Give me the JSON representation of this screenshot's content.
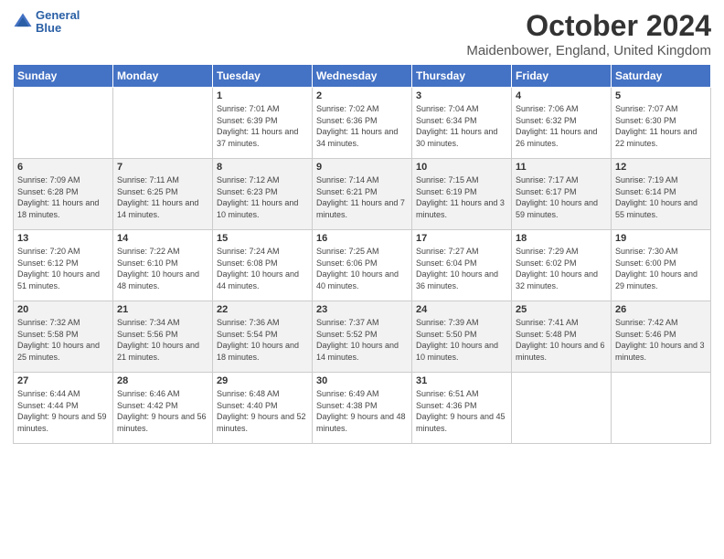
{
  "logo": {
    "line1": "General",
    "line2": "Blue"
  },
  "title": "October 2024",
  "subtitle": "Maidenbower, England, United Kingdom",
  "days_of_week": [
    "Sunday",
    "Monday",
    "Tuesday",
    "Wednesday",
    "Thursday",
    "Friday",
    "Saturday"
  ],
  "weeks": [
    [
      {
        "day": "",
        "info": ""
      },
      {
        "day": "",
        "info": ""
      },
      {
        "day": "1",
        "info": "Sunrise: 7:01 AM\nSunset: 6:39 PM\nDaylight: 11 hours and 37 minutes."
      },
      {
        "day": "2",
        "info": "Sunrise: 7:02 AM\nSunset: 6:36 PM\nDaylight: 11 hours and 34 minutes."
      },
      {
        "day": "3",
        "info": "Sunrise: 7:04 AM\nSunset: 6:34 PM\nDaylight: 11 hours and 30 minutes."
      },
      {
        "day": "4",
        "info": "Sunrise: 7:06 AM\nSunset: 6:32 PM\nDaylight: 11 hours and 26 minutes."
      },
      {
        "day": "5",
        "info": "Sunrise: 7:07 AM\nSunset: 6:30 PM\nDaylight: 11 hours and 22 minutes."
      }
    ],
    [
      {
        "day": "6",
        "info": "Sunrise: 7:09 AM\nSunset: 6:28 PM\nDaylight: 11 hours and 18 minutes."
      },
      {
        "day": "7",
        "info": "Sunrise: 7:11 AM\nSunset: 6:25 PM\nDaylight: 11 hours and 14 minutes."
      },
      {
        "day": "8",
        "info": "Sunrise: 7:12 AM\nSunset: 6:23 PM\nDaylight: 11 hours and 10 minutes."
      },
      {
        "day": "9",
        "info": "Sunrise: 7:14 AM\nSunset: 6:21 PM\nDaylight: 11 hours and 7 minutes."
      },
      {
        "day": "10",
        "info": "Sunrise: 7:15 AM\nSunset: 6:19 PM\nDaylight: 11 hours and 3 minutes."
      },
      {
        "day": "11",
        "info": "Sunrise: 7:17 AM\nSunset: 6:17 PM\nDaylight: 10 hours and 59 minutes."
      },
      {
        "day": "12",
        "info": "Sunrise: 7:19 AM\nSunset: 6:14 PM\nDaylight: 10 hours and 55 minutes."
      }
    ],
    [
      {
        "day": "13",
        "info": "Sunrise: 7:20 AM\nSunset: 6:12 PM\nDaylight: 10 hours and 51 minutes."
      },
      {
        "day": "14",
        "info": "Sunrise: 7:22 AM\nSunset: 6:10 PM\nDaylight: 10 hours and 48 minutes."
      },
      {
        "day": "15",
        "info": "Sunrise: 7:24 AM\nSunset: 6:08 PM\nDaylight: 10 hours and 44 minutes."
      },
      {
        "day": "16",
        "info": "Sunrise: 7:25 AM\nSunset: 6:06 PM\nDaylight: 10 hours and 40 minutes."
      },
      {
        "day": "17",
        "info": "Sunrise: 7:27 AM\nSunset: 6:04 PM\nDaylight: 10 hours and 36 minutes."
      },
      {
        "day": "18",
        "info": "Sunrise: 7:29 AM\nSunset: 6:02 PM\nDaylight: 10 hours and 32 minutes."
      },
      {
        "day": "19",
        "info": "Sunrise: 7:30 AM\nSunset: 6:00 PM\nDaylight: 10 hours and 29 minutes."
      }
    ],
    [
      {
        "day": "20",
        "info": "Sunrise: 7:32 AM\nSunset: 5:58 PM\nDaylight: 10 hours and 25 minutes."
      },
      {
        "day": "21",
        "info": "Sunrise: 7:34 AM\nSunset: 5:56 PM\nDaylight: 10 hours and 21 minutes."
      },
      {
        "day": "22",
        "info": "Sunrise: 7:36 AM\nSunset: 5:54 PM\nDaylight: 10 hours and 18 minutes."
      },
      {
        "day": "23",
        "info": "Sunrise: 7:37 AM\nSunset: 5:52 PM\nDaylight: 10 hours and 14 minutes."
      },
      {
        "day": "24",
        "info": "Sunrise: 7:39 AM\nSunset: 5:50 PM\nDaylight: 10 hours and 10 minutes."
      },
      {
        "day": "25",
        "info": "Sunrise: 7:41 AM\nSunset: 5:48 PM\nDaylight: 10 hours and 6 minutes."
      },
      {
        "day": "26",
        "info": "Sunrise: 7:42 AM\nSunset: 5:46 PM\nDaylight: 10 hours and 3 minutes."
      }
    ],
    [
      {
        "day": "27",
        "info": "Sunrise: 6:44 AM\nSunset: 4:44 PM\nDaylight: 9 hours and 59 minutes."
      },
      {
        "day": "28",
        "info": "Sunrise: 6:46 AM\nSunset: 4:42 PM\nDaylight: 9 hours and 56 minutes."
      },
      {
        "day": "29",
        "info": "Sunrise: 6:48 AM\nSunset: 4:40 PM\nDaylight: 9 hours and 52 minutes."
      },
      {
        "day": "30",
        "info": "Sunrise: 6:49 AM\nSunset: 4:38 PM\nDaylight: 9 hours and 48 minutes."
      },
      {
        "day": "31",
        "info": "Sunrise: 6:51 AM\nSunset: 4:36 PM\nDaylight: 9 hours and 45 minutes."
      },
      {
        "day": "",
        "info": ""
      },
      {
        "day": "",
        "info": ""
      }
    ]
  ]
}
